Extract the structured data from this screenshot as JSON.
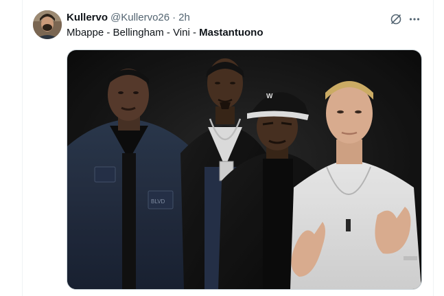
{
  "tweet": {
    "author_name": "Kullervo",
    "author_handle": "@Kullervo26",
    "separator": "·",
    "timestamp": "2h",
    "text_plain": "Mbappe - Bellingham - Vini - ",
    "text_bold": "Mastantuono",
    "avatar_icon": "user-avatar",
    "grok_icon": "grok-icon",
    "more_icon": "more-options-icon",
    "media_description_icon": "photo-image",
    "cap_logo": "W",
    "chain_text": "BLVD"
  },
  "colors": {
    "text_primary": "#0f1419",
    "text_secondary": "#536471",
    "border": "#cfd9de"
  }
}
